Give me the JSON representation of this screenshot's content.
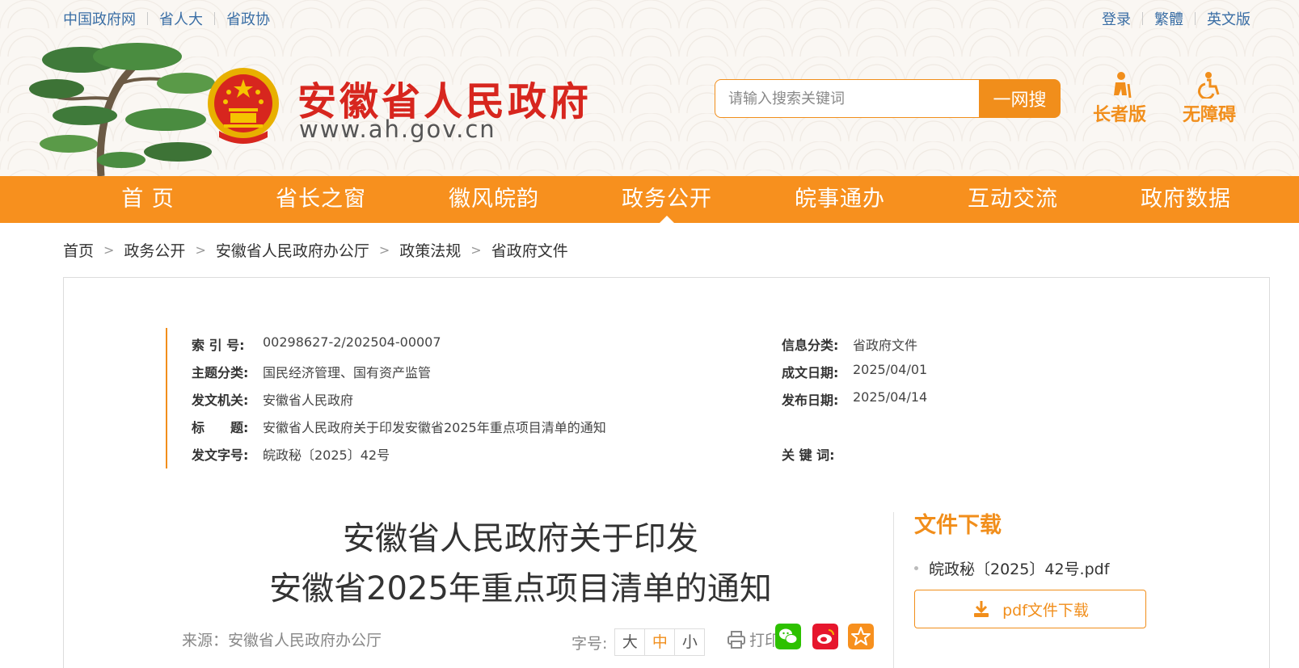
{
  "top_links": {
    "left": [
      "中国政府网",
      "省人大",
      "省政协"
    ],
    "right": [
      "登录",
      "繁體",
      "英文版"
    ]
  },
  "site": {
    "title": "安徽省人民政府",
    "url": "www.ah.gov.cn"
  },
  "search": {
    "placeholder": "请输入搜索关键词",
    "button": "一网搜"
  },
  "modes": {
    "elder": "长者版",
    "accessible": "无障碍"
  },
  "nav": [
    "首 页",
    "省长之窗",
    "徽风皖韵",
    "政务公开",
    "皖事通办",
    "互动交流",
    "政府数据"
  ],
  "nav_active": "政务公开",
  "breadcrumb": [
    "首页",
    "政务公开",
    "安徽省人民政府办公厅",
    "政策法规",
    "省政府文件"
  ],
  "meta": {
    "index_label": "索 引 号:",
    "index_value": "00298627-2/202504-00007",
    "info_class_label": "信息分类:",
    "info_class_value": "省政府文件",
    "topic_label": "主题分类:",
    "topic_value": "国民经济管理、国有资产监管",
    "written_date_label": "成文日期:",
    "written_date_value": "2025/04/01",
    "issuer_label": "发文机关:",
    "issuer_value": "安徽省人民政府",
    "publish_date_label": "发布日期:",
    "publish_date_value": "2025/04/14",
    "title_label": "标　　题:",
    "title_value": "安徽省人民政府关于印发安徽省2025年重点项目清单的通知",
    "doc_no_label": "发文字号:",
    "doc_no_value": "皖政秘〔2025〕42号",
    "keywords_label": "关 键 词:",
    "keywords_value": ""
  },
  "document": {
    "title_line1": "安徽省人民政府关于印发",
    "title_line2": "安徽省2025年重点项目清单的通知",
    "source": "来源：安徽省人民政府办公厅",
    "font_size_label": "字号:",
    "font_sizes": [
      "大",
      "中",
      "小"
    ],
    "font_size_selected": "中",
    "print_label": "打印"
  },
  "download": {
    "title": "文件下载",
    "file_name": "皖政秘〔2025〕42号.pdf",
    "button": "pdf文件下载"
  },
  "colors": {
    "accent": "#f7901e",
    "title_red": "#d7261e",
    "link_blue": "#3a6ea5",
    "wechat": "#2dc100",
    "weibo": "#e6162d",
    "favorite": "#f7901e"
  },
  "icons": [
    "huangshan-pine-icon",
    "national-emblem-icon",
    "elder-icon",
    "wheelchair-icon",
    "printer-icon",
    "wechat-icon",
    "weibo-icon",
    "star-icon",
    "download-icon"
  ]
}
